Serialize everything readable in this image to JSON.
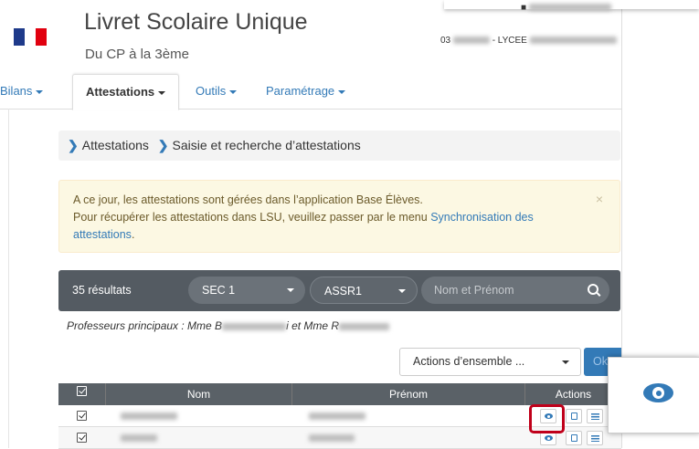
{
  "header": {
    "title": "Livret Scolaire Unique",
    "subtitle": "Du CP à la 3ème",
    "establishment_prefix": "03",
    "establishment_suffix": "- LYCEE"
  },
  "nav": {
    "items": [
      {
        "label": "Bilans"
      },
      {
        "label": "Attestations"
      },
      {
        "label": "Outils"
      },
      {
        "label": "Paramétrage"
      }
    ]
  },
  "breadcrumb": {
    "items": [
      "Attestations",
      "Saisie et recherche d’attestations"
    ]
  },
  "alert": {
    "line1": "A ce jour, les attestations sont gérées dans l’application Base Élèves.",
    "line2_text": "Pour récupérer les attestations dans LSU, veuillez passer par le menu ",
    "link": "Synchronisation des attestations",
    "line2_end": ".",
    "close": "×"
  },
  "filters": {
    "results": "35 résultats",
    "class_value": "SEC 1",
    "attestation_value": "ASSR1",
    "search_placeholder": "Nom et Prénom"
  },
  "profs": {
    "prefix": "Professeurs principaux : Mme B",
    "middle": "i et Mme R"
  },
  "bulk": {
    "actions_label": "Actions d’ensemble ...",
    "ok_label": "Ok"
  },
  "table": {
    "headers": {
      "nom": "Nom",
      "prenom": "Prénom",
      "actions": "Actions"
    }
  },
  "colors": {
    "accent": "#337ab7",
    "highlight": "#c0001a",
    "filter_bar": "#545b62",
    "alert_bg": "#fcf8e3"
  },
  "icons": [
    "search-icon",
    "eye-icon",
    "print-icon",
    "list-icon",
    "user-icon",
    "chevron-right-icon",
    "caret-down-icon"
  ]
}
